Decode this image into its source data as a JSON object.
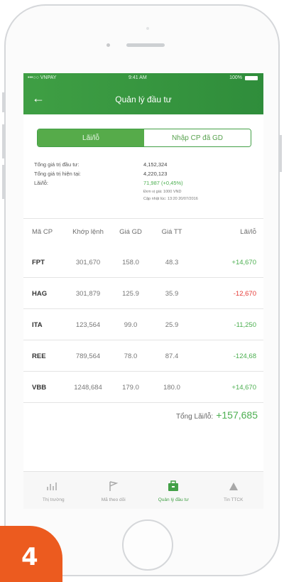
{
  "status_bar": {
    "carrier": "•••○○ VNPAY",
    "time": "9:41 AM",
    "battery": "100%"
  },
  "nav": {
    "title": "Quản lý đầu tư"
  },
  "segment": {
    "active": "Lãi/lỗ",
    "inactive": "Nhập CP đã GD"
  },
  "summary": {
    "rows": [
      {
        "label": "Tổng giá trị đầu tư:",
        "value": "4,152,324"
      },
      {
        "label": "Tổng giá trị hiện tại:",
        "value": "4,220,123"
      },
      {
        "label": "Lãi/lỗ:",
        "value": "71,987 (+0,45%)"
      }
    ],
    "unit_note": "Đơn vị giá: 1000 VND",
    "updated_note": "Cập nhật lúc: 13:20 20/07/2016"
  },
  "table": {
    "headers": [
      "Mã CP",
      "Khớp lệnh",
      "Giá GD",
      "Giá TT",
      "Lãi/lỗ"
    ],
    "rows": [
      {
        "code": "FPT",
        "match": "301,670",
        "trade_price": "158.0",
        "market_price": "48.3",
        "pnl": "+14,670",
        "pnl_sign": "pos"
      },
      {
        "code": "HAG",
        "match": "301,879",
        "trade_price": "125.9",
        "market_price": "35.9",
        "pnl": "-12,670",
        "pnl_sign": "neg"
      },
      {
        "code": "ITA",
        "match": "123,564",
        "trade_price": "99.0",
        "market_price": "25.9",
        "pnl": "-11,250",
        "pnl_sign": "pos"
      },
      {
        "code": "REE",
        "match": "789,564",
        "trade_price": "78.0",
        "market_price": "87.4",
        "pnl": "-124,68",
        "pnl_sign": "pos"
      },
      {
        "code": "VBB",
        "match": "1248,684",
        "trade_price": "179.0",
        "market_price": "180.0",
        "pnl": "+14,670",
        "pnl_sign": "pos"
      }
    ]
  },
  "total": {
    "label": "Tổng Lãi/lỗ:",
    "value": "+157,685"
  },
  "tabs": [
    {
      "label": "Thị trường",
      "icon": "market-chart-icon"
    },
    {
      "label": "Mã theo dõi",
      "icon": "watchlist-flag-icon"
    },
    {
      "label": "Quản lý đầu tư",
      "icon": "investment-wallet-icon",
      "active": true
    },
    {
      "label": "Tin TTCK",
      "icon": "news-icon"
    }
  ],
  "step_badge": "4",
  "colors": {
    "brand_green": "#3f9f44",
    "positive": "#4caf50",
    "negative": "#e53935",
    "badge": "#ec5b1f"
  }
}
